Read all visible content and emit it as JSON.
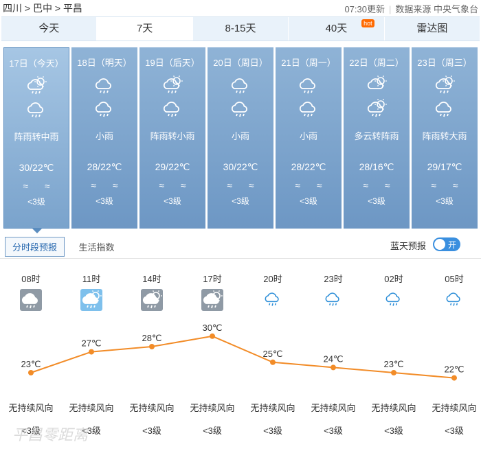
{
  "breadcrumb": {
    "a": "四川",
    "b": "巴中",
    "c": "平昌",
    "sep": ">"
  },
  "update": {
    "time": "07:30更新",
    "source": "数据来源 中央气象台"
  },
  "tabs": [
    {
      "label": "今天"
    },
    {
      "label": "7天"
    },
    {
      "label": "8-15天"
    },
    {
      "label": "40天",
      "badge": "hot"
    },
    {
      "label": "雷达图"
    }
  ],
  "days": [
    {
      "date": "17日（今天）",
      "desc": "阵雨转中雨",
      "temp": "30/22℃",
      "wind": "≈ ≈",
      "level": "<3级",
      "icon1": "shower-icon",
      "icon2": "rain-icon"
    },
    {
      "date": "18日（明天）",
      "desc": "小雨",
      "temp": "28/22℃",
      "wind": "≈ ≈",
      "level": "<3级",
      "icon1": "rain-icon",
      "icon2": "rain-icon"
    },
    {
      "date": "19日（后天）",
      "desc": "阵雨转小雨",
      "temp": "29/22℃",
      "wind": "≈ ≈",
      "level": "<3级",
      "icon1": "shower-icon",
      "icon2": "rain-icon"
    },
    {
      "date": "20日（周日）",
      "desc": "小雨",
      "temp": "30/22℃",
      "wind": "≈ ≈",
      "level": "<3级",
      "icon1": "rain-icon",
      "icon2": "rain-icon"
    },
    {
      "date": "21日（周一）",
      "desc": "小雨",
      "temp": "28/22℃",
      "wind": "≈ ≈",
      "level": "<3级",
      "icon1": "rain-icon",
      "icon2": "rain-icon"
    },
    {
      "date": "22日（周二）",
      "desc": "多云转阵雨",
      "temp": "28/16℃",
      "wind": "≈ ≈",
      "level": "<3级",
      "icon1": "cloudy-icon",
      "icon2": "shower-icon"
    },
    {
      "date": "23日（周三）",
      "desc": "阵雨转大雨",
      "temp": "29/17℃",
      "wind": "≈ ≈",
      "level": "<3级",
      "icon1": "shower-icon",
      "icon2": "rain-icon"
    }
  ],
  "subtabs": [
    {
      "label": "分时段预报"
    },
    {
      "label": "生活指数"
    }
  ],
  "bluesky": {
    "label": "蓝天预报",
    "toggle": "开"
  },
  "hours": [
    {
      "time": "08时",
      "temp": "23℃",
      "wind": "无持续风向",
      "level": "<3级"
    },
    {
      "time": "11时",
      "temp": "27℃",
      "wind": "无持续风向",
      "level": "<3级"
    },
    {
      "time": "14时",
      "temp": "28℃",
      "wind": "无持续风向",
      "level": "<3级"
    },
    {
      "time": "17时",
      "temp": "30℃",
      "wind": "无持续风向",
      "level": "<3级"
    },
    {
      "time": "20时",
      "temp": "25℃",
      "wind": "无持续风向",
      "level": "<3级"
    },
    {
      "time": "23时",
      "temp": "24℃",
      "wind": "无持续风向",
      "level": "<3级"
    },
    {
      "time": "02时",
      "temp": "23℃",
      "wind": "无持续风向",
      "level": "<3级"
    },
    {
      "time": "05时",
      "temp": "22℃",
      "wind": "无持续风向",
      "level": "<3级"
    }
  ],
  "hour_temps": [
    23,
    27,
    28,
    30,
    25,
    24,
    23,
    22
  ],
  "watermark": "平昌零距离",
  "colors": {
    "line": "#f28c28",
    "card": "#7aa3cc",
    "accent": "#3a8fdf"
  }
}
